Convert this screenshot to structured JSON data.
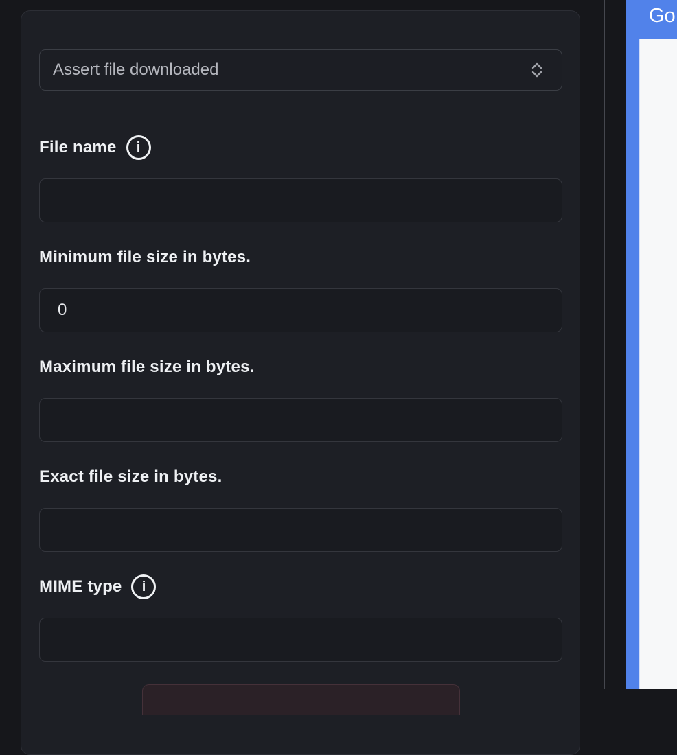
{
  "step": {
    "type_selector": {
      "value": "Assert file downloaded"
    },
    "fields": [
      {
        "label": "File name",
        "has_info": true,
        "value": ""
      },
      {
        "label": "Minimum file size in bytes.",
        "has_info": false,
        "value": "0"
      },
      {
        "label": "Maximum file size in bytes.",
        "has_info": false,
        "value": ""
      },
      {
        "label": "Exact file size in bytes.",
        "has_info": false,
        "value": ""
      },
      {
        "label": "MIME type",
        "has_info": true,
        "value": ""
      }
    ],
    "info_icon_glyph": "i"
  },
  "right_panel": {
    "header_label": "Go"
  },
  "icons": {
    "select": "up-down-chevron-icon",
    "info": "info-circle-icon"
  },
  "colors": {
    "accent_blue": "#5182ea",
    "page_background": "#16171b",
    "card_background": "#1d1f25",
    "input_background": "#191b20",
    "right_panel_background": "#f7f8f9",
    "danger_button_background": "#2b2127"
  }
}
